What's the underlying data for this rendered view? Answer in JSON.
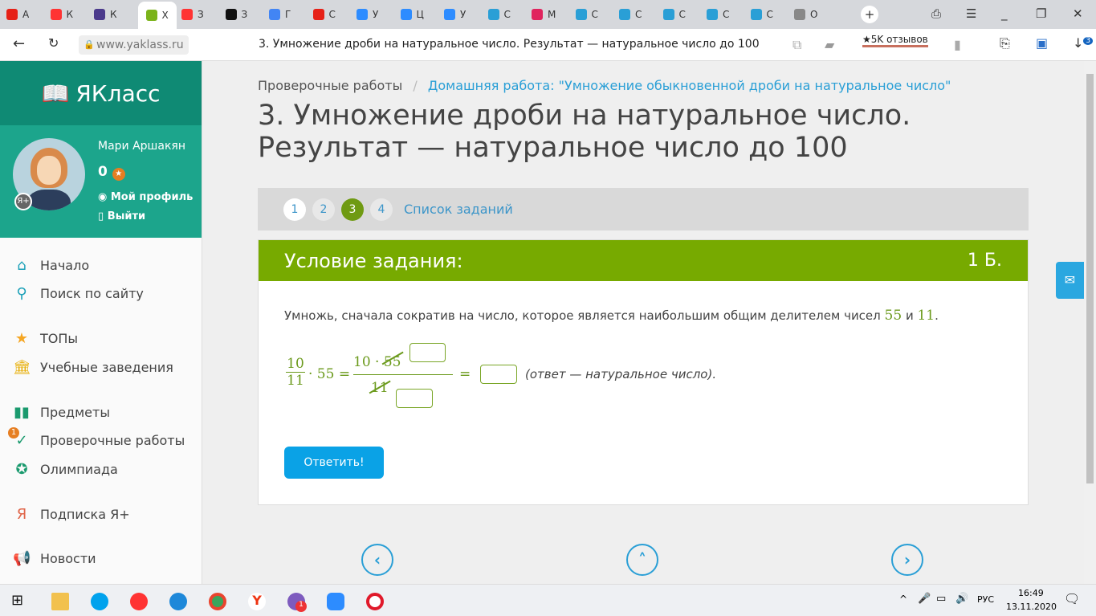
{
  "browser": {
    "tabs": [
      {
        "label": "А",
        "color": "#e62117"
      },
      {
        "label": "К",
        "color": "#f33"
      },
      {
        "label": "К",
        "color": "#4b3a8c"
      },
      {
        "label": "Х",
        "color": "#7bb31a"
      },
      {
        "label": "З",
        "color": "#f33"
      },
      {
        "label": "З",
        "color": "#111"
      },
      {
        "label": "Г",
        "color": "#4285f4"
      },
      {
        "label": "С",
        "color": "#e62117"
      },
      {
        "label": "У",
        "color": "#2d8cff"
      },
      {
        "label": "Ц",
        "color": "#2d8cff"
      },
      {
        "label": "У",
        "color": "#2d8cff"
      },
      {
        "label": "С",
        "color": "#2a9fd6"
      },
      {
        "label": "М",
        "color": "#e0245e"
      },
      {
        "label": "С",
        "color": "#2a9fd6"
      },
      {
        "label": "С",
        "color": "#2a9fd6"
      },
      {
        "label": "С",
        "color": "#2a9fd6"
      },
      {
        "label": "С",
        "color": "#2a9fd6"
      },
      {
        "label": "С",
        "color": "#2a9fd6"
      },
      {
        "label": "О",
        "color": "#888"
      }
    ],
    "url": "www.yaklass.ru",
    "page_title": "3. Умножение дроби на натуральное число. Результат — натуральное число до 100",
    "reviews": "★5K отзывов",
    "downloads_badge": "3"
  },
  "sidebar": {
    "logo": "ЯКласс",
    "user_name": "Мари Аршакян",
    "points": "0",
    "profile_link": "Мой профиль",
    "logout_link": "Выйти",
    "items": [
      {
        "label": "Начало",
        "icon": "⌂",
        "color": "#1aa0b8"
      },
      {
        "label": "Поиск по сайту",
        "icon": "⚲",
        "color": "#1aa0b8"
      },
      {
        "label": "ТОПы",
        "icon": "★",
        "color": "#f5a623"
      },
      {
        "label": "Учебные заведения",
        "icon": "🏛",
        "color": "#e8b10f"
      },
      {
        "label": "Предметы",
        "icon": "▮▮",
        "color": "#1a9a6e"
      },
      {
        "label": "Проверочные работы",
        "icon": "✓",
        "color": "#1a9a6e",
        "badge": "1"
      },
      {
        "label": "Олимпиада",
        "icon": "✪",
        "color": "#1a9a6e"
      },
      {
        "label": "Подписка Я+",
        "icon": "Я",
        "color": "#e0664a"
      },
      {
        "label": "Новости",
        "icon": "📢",
        "color": "#4a5a6a"
      }
    ]
  },
  "main": {
    "breadcrumb_root": "Проверочные работы",
    "breadcrumb_sep": "/",
    "breadcrumb_current": "Домашняя работа: \"Умножение обыкновенной дроби на натуральное число\"",
    "title": "3. Умножение дроби на натуральное число. Результат — натуральное число до 100",
    "pages": [
      "1",
      "2",
      "3",
      "4"
    ],
    "active_page": "3",
    "task_list": "Список заданий",
    "task_header": "Условие задания:",
    "points": "1 Б.",
    "question_prefix": "Умножь, сначала сократив на число, которое является наибольшим общим делителем чисел ",
    "n1": "55",
    "and": " и ",
    "n2": "11",
    "period": ".",
    "frac_num": "10",
    "frac_den": "11",
    "times": "· 55 =",
    "big_num": "10 · 55",
    "big_den": "11",
    "eq": "=",
    "hint": "(ответ — натуральное число).",
    "submit": "Ответить!"
  },
  "taskbar": {
    "lang": "РУС",
    "time": "16:49",
    "date": "13.11.2020",
    "viber_badge": "1"
  }
}
